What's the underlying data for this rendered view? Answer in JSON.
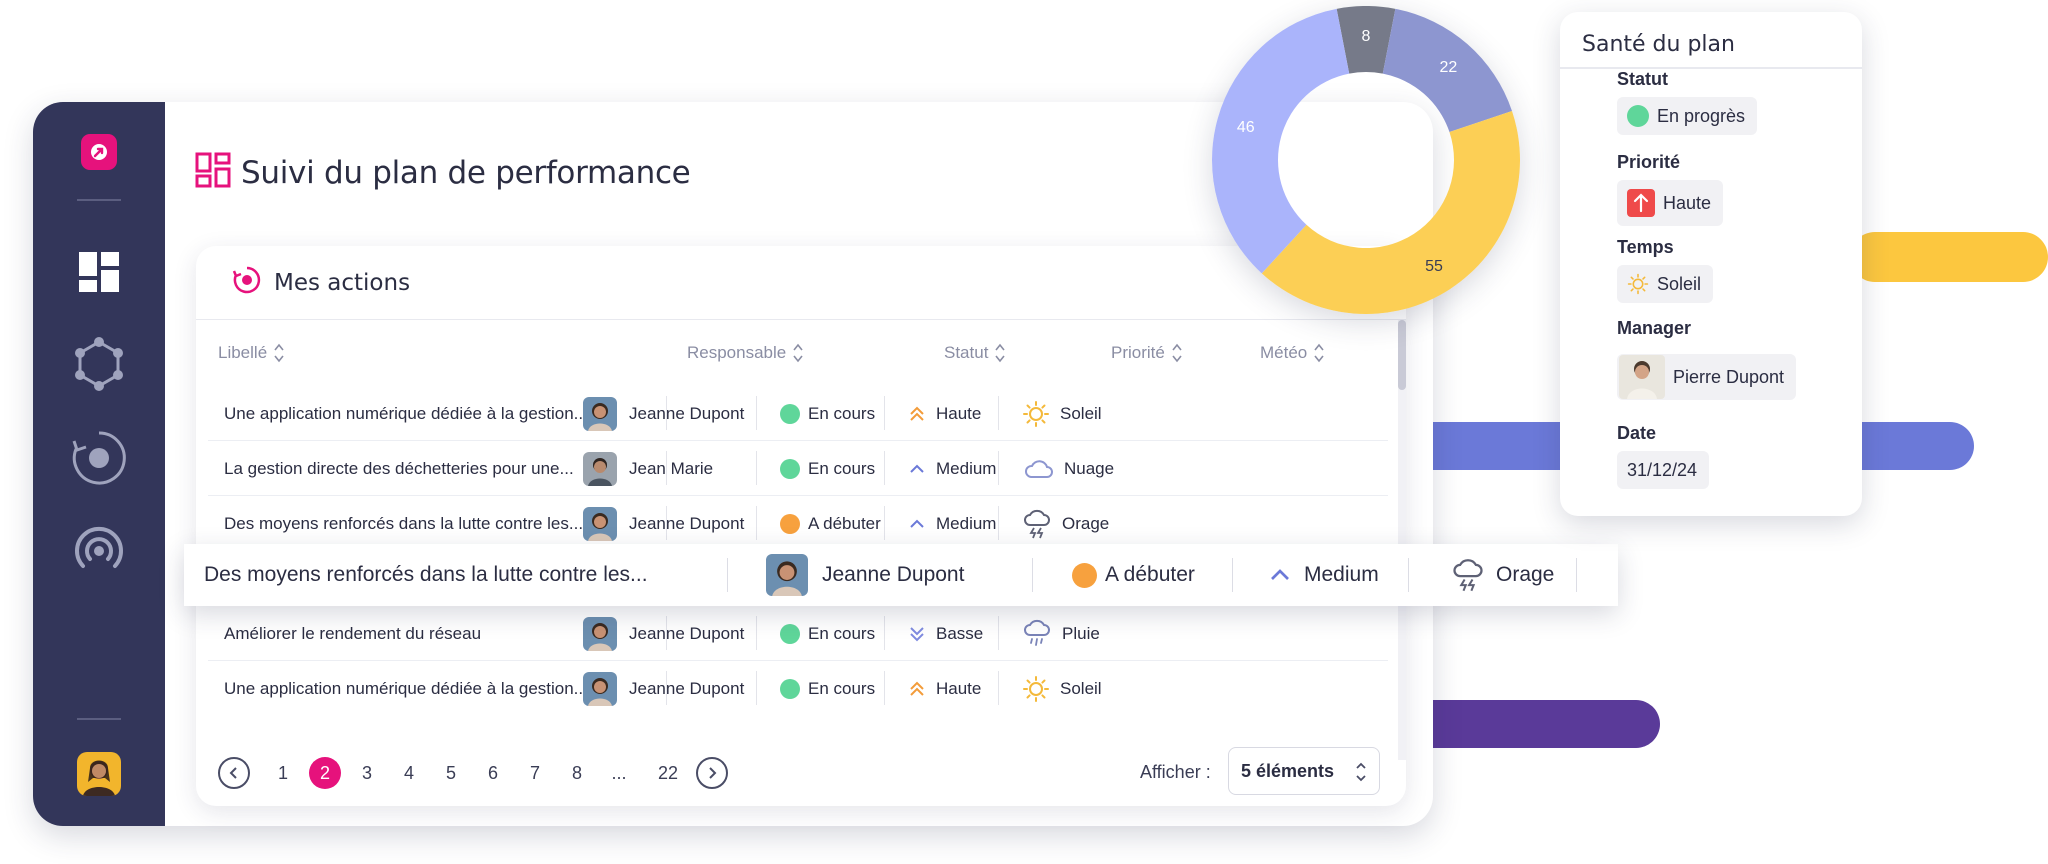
{
  "page_title": "Suivi du plan de performance",
  "actions": {
    "title": "Mes actions",
    "columns": [
      "Libellé",
      "Responsable",
      "Statut",
      "Priorité",
      "Météo"
    ],
    "rows": [
      {
        "libelle": "Une application numérique dédiée à la gestion...",
        "responsable": "Jeanne Dupont",
        "statut": "En cours",
        "priorite": "Haute",
        "meteo": "Soleil"
      },
      {
        "libelle": "La gestion directe des déchetteries pour une...",
        "responsable": "Jean Marie",
        "statut": "En cours",
        "priorite": "Medium",
        "meteo": "Nuage"
      },
      {
        "libelle": "Des moyens renforcés dans la lutte contre les...",
        "responsable": "Jeanne Dupont",
        "statut": "A débuter",
        "priorite": "Medium",
        "meteo": "Orage"
      },
      {
        "libelle": "Améliorer le rendement du réseau",
        "responsable": "Jeanne Dupont",
        "statut": "En cours",
        "priorite": "Basse",
        "meteo": "Pluie"
      },
      {
        "libelle": "Une application numérique dédiée à la gestion...",
        "responsable": "Jeanne Dupont",
        "statut": "En cours",
        "priorite": "Haute",
        "meteo": "Soleil"
      }
    ],
    "highlighted_row": {
      "libelle": "Des moyens renforcés dans la lutte contre les...",
      "responsable": "Jeanne Dupont",
      "statut": "A débuter",
      "priorite": "Medium",
      "meteo": "Orage"
    }
  },
  "pagination": {
    "pages": [
      "1",
      "2",
      "3",
      "4",
      "5",
      "6",
      "7",
      "8",
      "...",
      "22"
    ],
    "current": "2",
    "show_label": "Afficher :",
    "page_size": "5 éléments"
  },
  "health": {
    "title": "Santé du plan",
    "status_label": "Statut",
    "status_value": "En progrès",
    "priority_label": "Priorité",
    "priority_value": "Haute",
    "weather_label": "Temps",
    "weather_value": "Soleil",
    "manager_label": "Manager",
    "manager_value": "Pierre Dupont",
    "date_label": "Date",
    "date_value": "31/12/24"
  },
  "chart_data": {
    "type": "pie",
    "values": [
      8,
      22,
      55,
      46
    ],
    "colors": [
      "#767a89",
      "#8d96d0",
      "#fccf55",
      "#aab4fb"
    ]
  },
  "colors": {
    "sidebar": "#33365a",
    "accent": "#e6127c",
    "status_green": "#5fd69a",
    "status_orange": "#f7a13e",
    "priority_red": "#ef4a4a"
  },
  "icons": {
    "sidebar": [
      "dashboard-icon",
      "network-icon",
      "target-icon",
      "broadcast-icon"
    ]
  }
}
